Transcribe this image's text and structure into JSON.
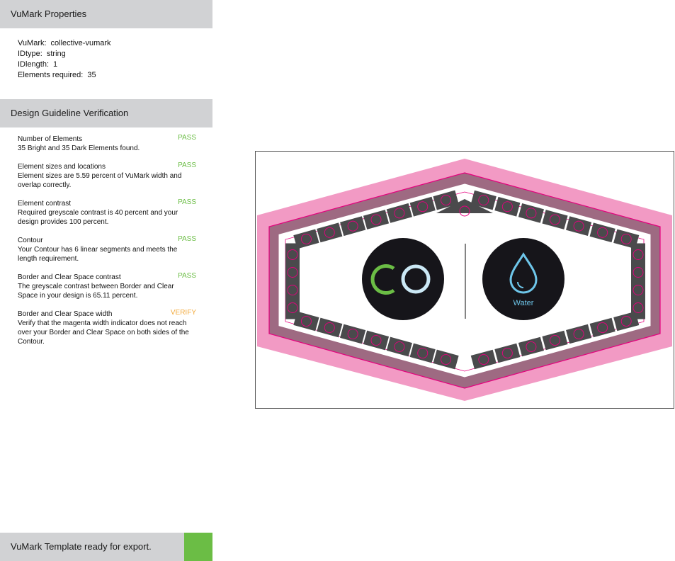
{
  "properties": {
    "header": "VuMark Properties",
    "vumark_label": "VuMark:",
    "vumark_value": "collective-vumark",
    "idtype_label": "IDtype:",
    "idtype_value": "string",
    "idlength_label": "IDlength:",
    "idlength_value": "1",
    "elements_label": "Elements required:",
    "elements_value": "35"
  },
  "verification": {
    "header": "Design Guideline Verification",
    "checks": [
      {
        "title": "Number of Elements",
        "desc": "35 Bright and 35 Dark Elements found.",
        "status": "PASS"
      },
      {
        "title": "Element sizes and locations",
        "desc": "Element sizes are 5.59 percent of VuMark width and overlap correctly.",
        "status": "PASS"
      },
      {
        "title": "Element contrast",
        "desc": "Required greyscale contrast is 40 percent and your design provides 100 percent.",
        "status": "PASS"
      },
      {
        "title": "Contour",
        "desc": "Your Contour has 6 linear segments and meets the length requirement.",
        "status": "PASS"
      },
      {
        "title": "Border and Clear Space contrast",
        "desc": "The greyscale contrast between Border and Clear Space in your design is 65.11 percent.",
        "status": "PASS"
      },
      {
        "title": "Border and Clear Space width",
        "desc": "Verify that the magenta width indicator does not reach over your Border and Clear Space on both sides of the Contour.",
        "status": "VERIFY"
      }
    ]
  },
  "footer": {
    "message": "VuMark Template ready for export."
  },
  "preview": {
    "logo_label": "Water"
  },
  "colors": {
    "pass": "#6bbd45",
    "verify": "#f2a93b",
    "magenta": "#e6007e",
    "border_pink": "#f29ac4",
    "dark_band": "#9e6a82",
    "water_blue": "#6ec6ea"
  }
}
